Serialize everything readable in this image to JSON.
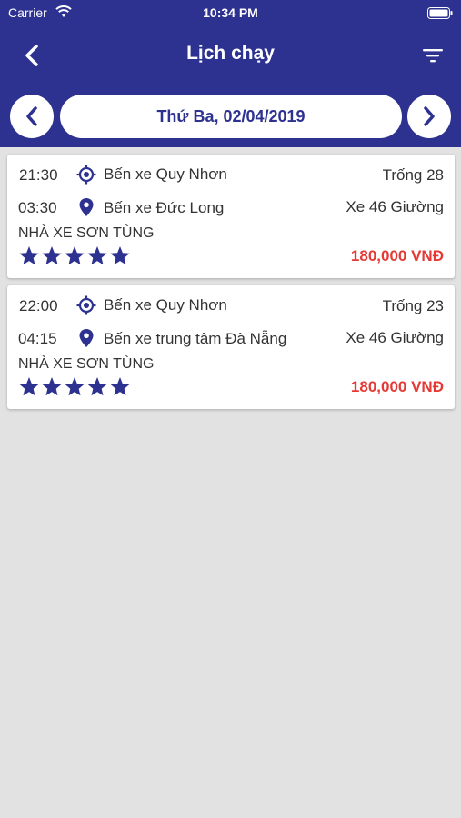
{
  "status_bar": {
    "carrier": "Carrier",
    "time": "10:34 PM"
  },
  "nav": {
    "title": "Lịch chạy",
    "back_icon": "chevron-left-icon",
    "filter_icon": "filter-icon"
  },
  "date_picker": {
    "date_label": "Thứ Ba, 02/04/2019",
    "prev_icon": "chevron-left-icon",
    "next_icon": "chevron-right-icon"
  },
  "colors": {
    "primary": "#2d3290",
    "price": "#e53935",
    "background": "#e2e2e2"
  },
  "trips": [
    {
      "departure_time": "21:30",
      "origin": "Bến xe Quy Nhơn",
      "seats_left": "Trống 28",
      "arrival_time": "03:30",
      "destination": "Bến xe Đức Long",
      "bus_type": "Xe 46 Giường",
      "operator": "NHÀ XE SƠN TÙNG",
      "rating": 5,
      "price": "180,000 VNĐ"
    },
    {
      "departure_time": "22:00",
      "origin": "Bến xe Quy Nhơn",
      "seats_left": "Trống 23",
      "arrival_time": "04:15",
      "destination": "Bến xe trung tâm Đà Nẵng",
      "bus_type": "Xe 46 Giường",
      "operator": "NHÀ XE SƠN TÙNG",
      "rating": 5,
      "price": "180,000 VNĐ"
    }
  ]
}
